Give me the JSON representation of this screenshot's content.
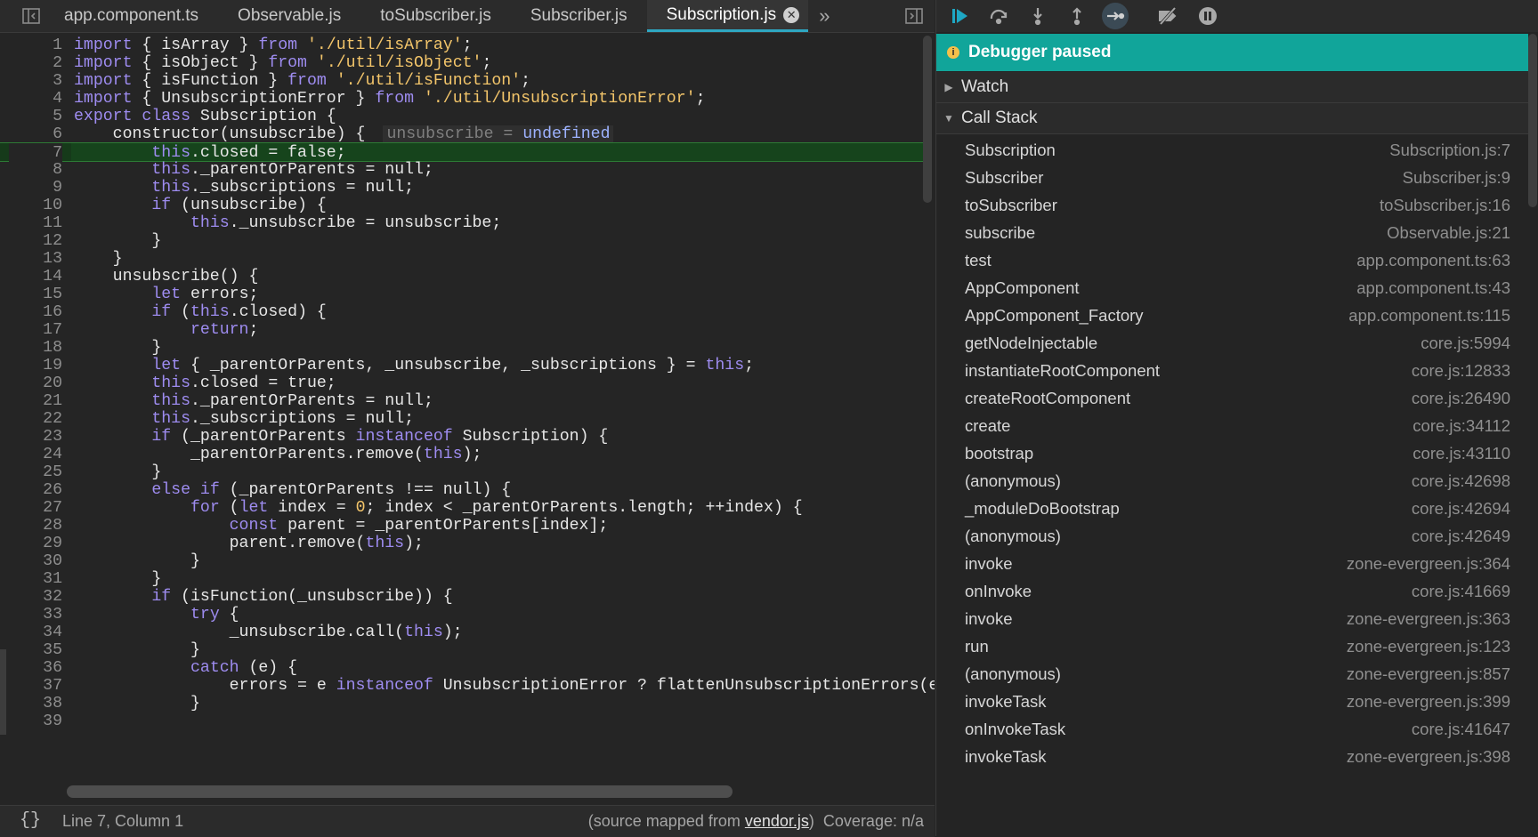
{
  "tabs": [
    {
      "label": "app.component.ts",
      "active": false
    },
    {
      "label": "Observable.js",
      "active": false
    },
    {
      "label": "toSubscriber.js",
      "active": false
    },
    {
      "label": "Subscriber.js",
      "active": false
    },
    {
      "label": "Subscription.js",
      "active": true
    }
  ],
  "tab_overflow": "»",
  "tab_close_glyph": "✕",
  "icons": {
    "left_toggle": "toggle-navigator-icon",
    "right_toggle": "toggle-debugger-icon"
  },
  "editor": {
    "current_line": 7,
    "inline_value": {
      "name": "unsubscribe",
      "eq": "=",
      "value": "undefined"
    },
    "lines": [
      "import { isArray } from './util/isArray';",
      "import { isObject } from './util/isObject';",
      "import { isFunction } from './util/isFunction';",
      "import { UnsubscriptionError } from './util/UnsubscriptionError';",
      "export class Subscription {",
      "    constructor(unsubscribe) {",
      "        this.closed = false;",
      "        this._parentOrParents = null;",
      "        this._subscriptions = null;",
      "        if (unsubscribe) {",
      "            this._unsubscribe = unsubscribe;",
      "        }",
      "    }",
      "    unsubscribe() {",
      "        let errors;",
      "        if (this.closed) {",
      "            return;",
      "        }",
      "        let { _parentOrParents, _unsubscribe, _subscriptions } = this;",
      "        this.closed = true;",
      "        this._parentOrParents = null;",
      "        this._subscriptions = null;",
      "        if (_parentOrParents instanceof Subscription) {",
      "            _parentOrParents.remove(this);",
      "        }",
      "        else if (_parentOrParents !== null) {",
      "            for (let index = 0; index < _parentOrParents.length; ++index) {",
      "                const parent = _parentOrParents[index];",
      "                parent.remove(this);",
      "            }",
      "        }",
      "        if (isFunction(_unsubscribe)) {",
      "            try {",
      "                _unsubscribe.call(this);",
      "            }",
      "            catch (e) {",
      "                errors = e instanceof UnsubscriptionError ? flattenUnsubscriptionErrors(e.er",
      "            }",
      ""
    ]
  },
  "status": {
    "braces": "{}",
    "position": "Line 7, Column 1",
    "source_prefix": "(source mapped from ",
    "source_link": "vendor.js",
    "source_suffix": ")",
    "coverage": "Coverage: n/a"
  },
  "debugger": {
    "toolbar_icons": [
      "resume-icon",
      "step-over-icon",
      "step-into-icon",
      "step-out-icon",
      "step-icon",
      "deactivate-breakpoints-icon",
      "pause-on-exceptions-icon"
    ],
    "banner": "Debugger paused",
    "banner_icon": "i",
    "watch_label": "Watch",
    "callstack_label": "Call Stack",
    "frames": [
      {
        "fn": "Subscription",
        "loc": "Subscription.js:7"
      },
      {
        "fn": "Subscriber",
        "loc": "Subscriber.js:9"
      },
      {
        "fn": "toSubscriber",
        "loc": "toSubscriber.js:16"
      },
      {
        "fn": "subscribe",
        "loc": "Observable.js:21"
      },
      {
        "fn": "test",
        "loc": "app.component.ts:63"
      },
      {
        "fn": "AppComponent",
        "loc": "app.component.ts:43"
      },
      {
        "fn": "AppComponent_Factory",
        "loc": "app.component.ts:115"
      },
      {
        "fn": "getNodeInjectable",
        "loc": "core.js:5994"
      },
      {
        "fn": "instantiateRootComponent",
        "loc": "core.js:12833"
      },
      {
        "fn": "createRootComponent",
        "loc": "core.js:26490"
      },
      {
        "fn": "create",
        "loc": "core.js:34112"
      },
      {
        "fn": "bootstrap",
        "loc": "core.js:43110"
      },
      {
        "fn": "(anonymous)",
        "loc": "core.js:42698"
      },
      {
        "fn": "_moduleDoBootstrap",
        "loc": "core.js:42694"
      },
      {
        "fn": "(anonymous)",
        "loc": "core.js:42649"
      },
      {
        "fn": "invoke",
        "loc": "zone-evergreen.js:364"
      },
      {
        "fn": "onInvoke",
        "loc": "core.js:41669"
      },
      {
        "fn": "invoke",
        "loc": "zone-evergreen.js:363"
      },
      {
        "fn": "run",
        "loc": "zone-evergreen.js:123"
      },
      {
        "fn": "(anonymous)",
        "loc": "zone-evergreen.js:857"
      },
      {
        "fn": "invokeTask",
        "loc": "zone-evergreen.js:399"
      },
      {
        "fn": "onInvokeTask",
        "loc": "core.js:41647"
      },
      {
        "fn": "invokeTask",
        "loc": "zone-evergreen.js:398"
      }
    ]
  }
}
